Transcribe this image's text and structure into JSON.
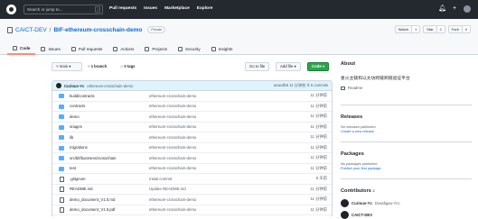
{
  "topnav": {
    "search_placeholder": "Search or jump to...",
    "search_key": "/",
    "links": [
      "Pull requests",
      "Issues",
      "Marketplace",
      "Explore"
    ]
  },
  "repo": {
    "owner": "CAICT-DEV",
    "name": "BIF-ethereum-crosschain-demo",
    "visibility": "Private",
    "actions": [
      {
        "label": "Watch",
        "count": "1"
      },
      {
        "label": "Star",
        "count": "2"
      },
      {
        "label": "Fork",
        "count": "0"
      }
    ],
    "tabs": [
      "Code",
      "Issues",
      "Pull requests",
      "Actions",
      "Projects",
      "Security",
      "Insights"
    ]
  },
  "branchbar": {
    "branch": "main",
    "branches": "1 branch",
    "tags": "0 tags",
    "goto_file": "Go to file",
    "add_file": "Add file",
    "code": "Code"
  },
  "commit": {
    "user": "Curious-Yc",
    "message": "ethereum-crosschain-demo",
    "right": "aeacdb6 11 分钟前  ⏱ 6 commits"
  },
  "files": [
    {
      "type": "dir",
      "name": "build/contracts",
      "msg": "ethereum-crosschain-demo",
      "age": "11 分钟前"
    },
    {
      "type": "dir",
      "name": "contracts",
      "msg": "ethereum-crosschain-demo",
      "age": "11 分钟前"
    },
    {
      "type": "dir",
      "name": "demo",
      "msg": "ethereum-crosschain-demo",
      "age": "11 分钟前"
    },
    {
      "type": "dir",
      "name": "images",
      "msg": "ethereum-crosschain-demo",
      "age": "11 分钟前"
    },
    {
      "type": "dir",
      "name": "lib",
      "msg": "ethereum-crosschain-demo",
      "age": "11 分钟前"
    },
    {
      "type": "dir",
      "name": "migrations",
      "msg": "ethereum-crosschain-demo",
      "age": "11 分钟前"
    },
    {
      "type": "dir",
      "name": "src/bif/business/crosschain",
      "msg": "ethereum-crosschain-demo",
      "age": "11 分钟前"
    },
    {
      "type": "dir",
      "name": "test",
      "msg": "ethereum-crosschain-demo",
      "age": "11 分钟前"
    },
    {
      "type": "file",
      "name": ".gitignore",
      "msg": "Initial commit",
      "age": "5 天前"
    },
    {
      "type": "file",
      "name": "README.md",
      "msg": "Update README.md",
      "age": "11 分钟前"
    },
    {
      "type": "file",
      "name": "demo_document_V1.0.md",
      "msg": "ethereum-crosschain-demo",
      "age": "11 分钟前"
    },
    {
      "type": "file",
      "name": "demo_document_V1.0.pdf",
      "msg": "ethereum-crosschain-demo",
      "age": "11 分钟前"
    }
  ],
  "sidebar": {
    "about_title": "About",
    "description": "星火主链和以太坊跨链跨链验证平台",
    "readme": "Readme",
    "releases_title": "Releases",
    "releases_text": "No releases published",
    "releases_link": "Create a new release",
    "packages_title": "Packages",
    "packages_text": "No packages published",
    "packages_link": "Publish your first package",
    "contributors_title": "Contributors",
    "contributors_count": "2",
    "contributors": [
      {
        "user": "Curious-Yc",
        "name": "Dowdigao-Ycc"
      },
      {
        "user": "CAICT-DEV",
        "name": ""
      }
    ]
  }
}
